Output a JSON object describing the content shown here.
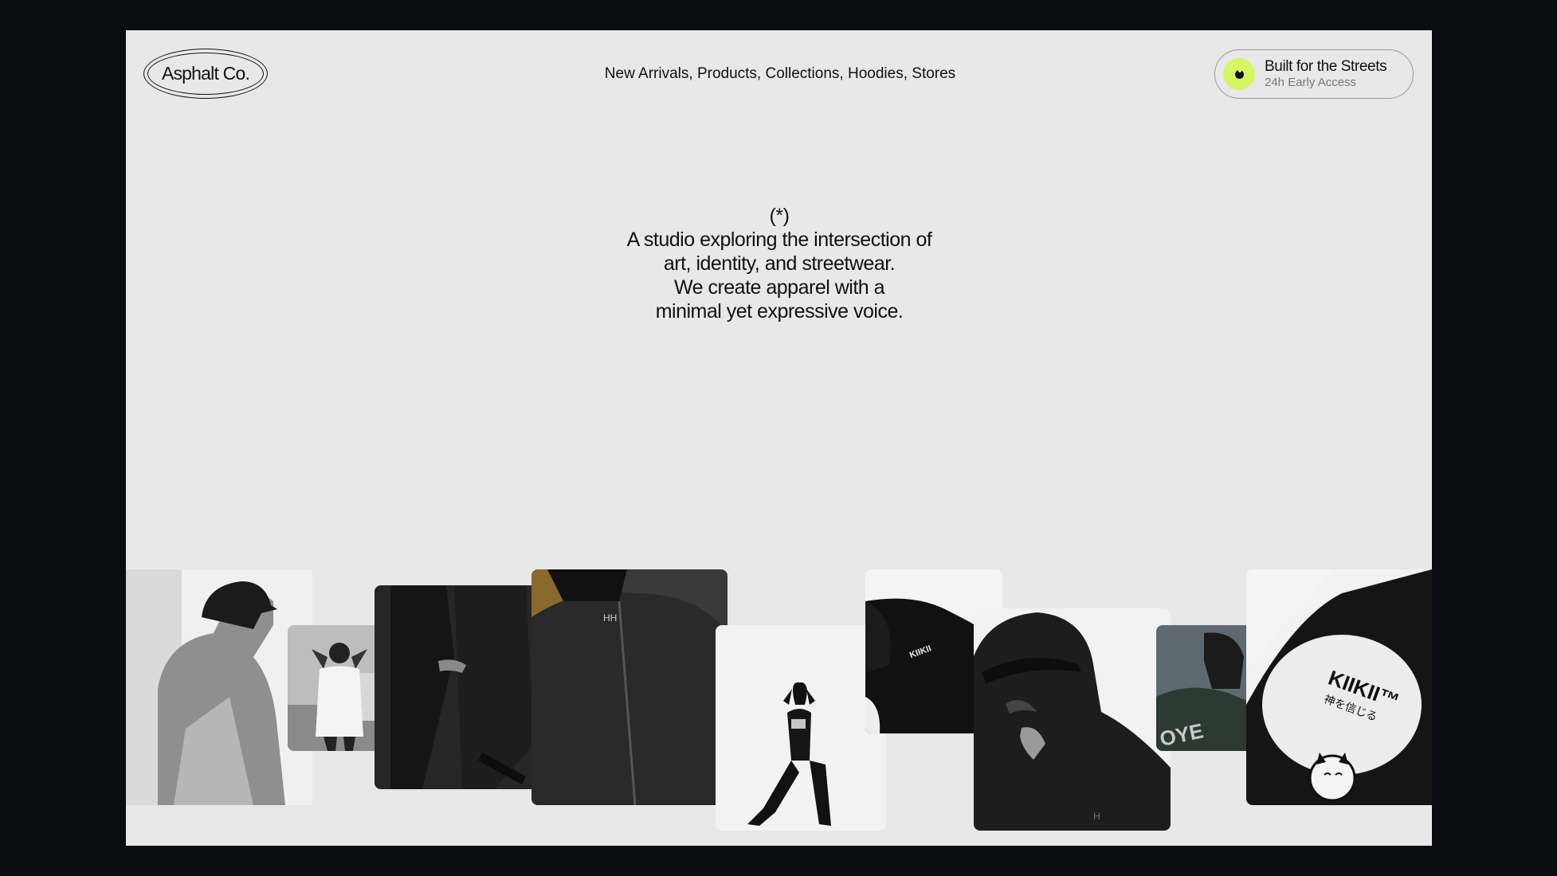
{
  "brand": {
    "logo_text": "Asphalt Co."
  },
  "nav": {
    "items": [
      {
        "label": "New Arrivals"
      },
      {
        "label": "Products"
      },
      {
        "label": "Collections"
      },
      {
        "label": "Hoodies"
      },
      {
        "label": "Stores"
      }
    ],
    "separator": ", "
  },
  "cta": {
    "title": "Built for the Streets",
    "subtitle": "24h Early Access",
    "accent_color": "#d8f564",
    "icon": "flame-icon"
  },
  "hero": {
    "mark": "(*)",
    "lines": [
      "A studio exploring the intersection of",
      "art, identity, and streetwear.",
      "We create apparel with a",
      "minimal yet expressive voice."
    ]
  },
  "gallery": {
    "photos": [
      {
        "name": "photo-hooded-profile"
      },
      {
        "name": "photo-white-tee-pose"
      },
      {
        "name": "photo-black-coat-detail"
      },
      {
        "name": "photo-black-jacket"
      },
      {
        "name": "photo-dancer-pose"
      },
      {
        "name": "photo-tee-collar-label",
        "text": "KIIKII"
      },
      {
        "name": "photo-cap-glasses-portrait"
      },
      {
        "name": "photo-varsity-back"
      },
      {
        "name": "photo-tee-print-cat",
        "text": "KIIKII™",
        "subtext": "神を信じる"
      }
    ]
  }
}
